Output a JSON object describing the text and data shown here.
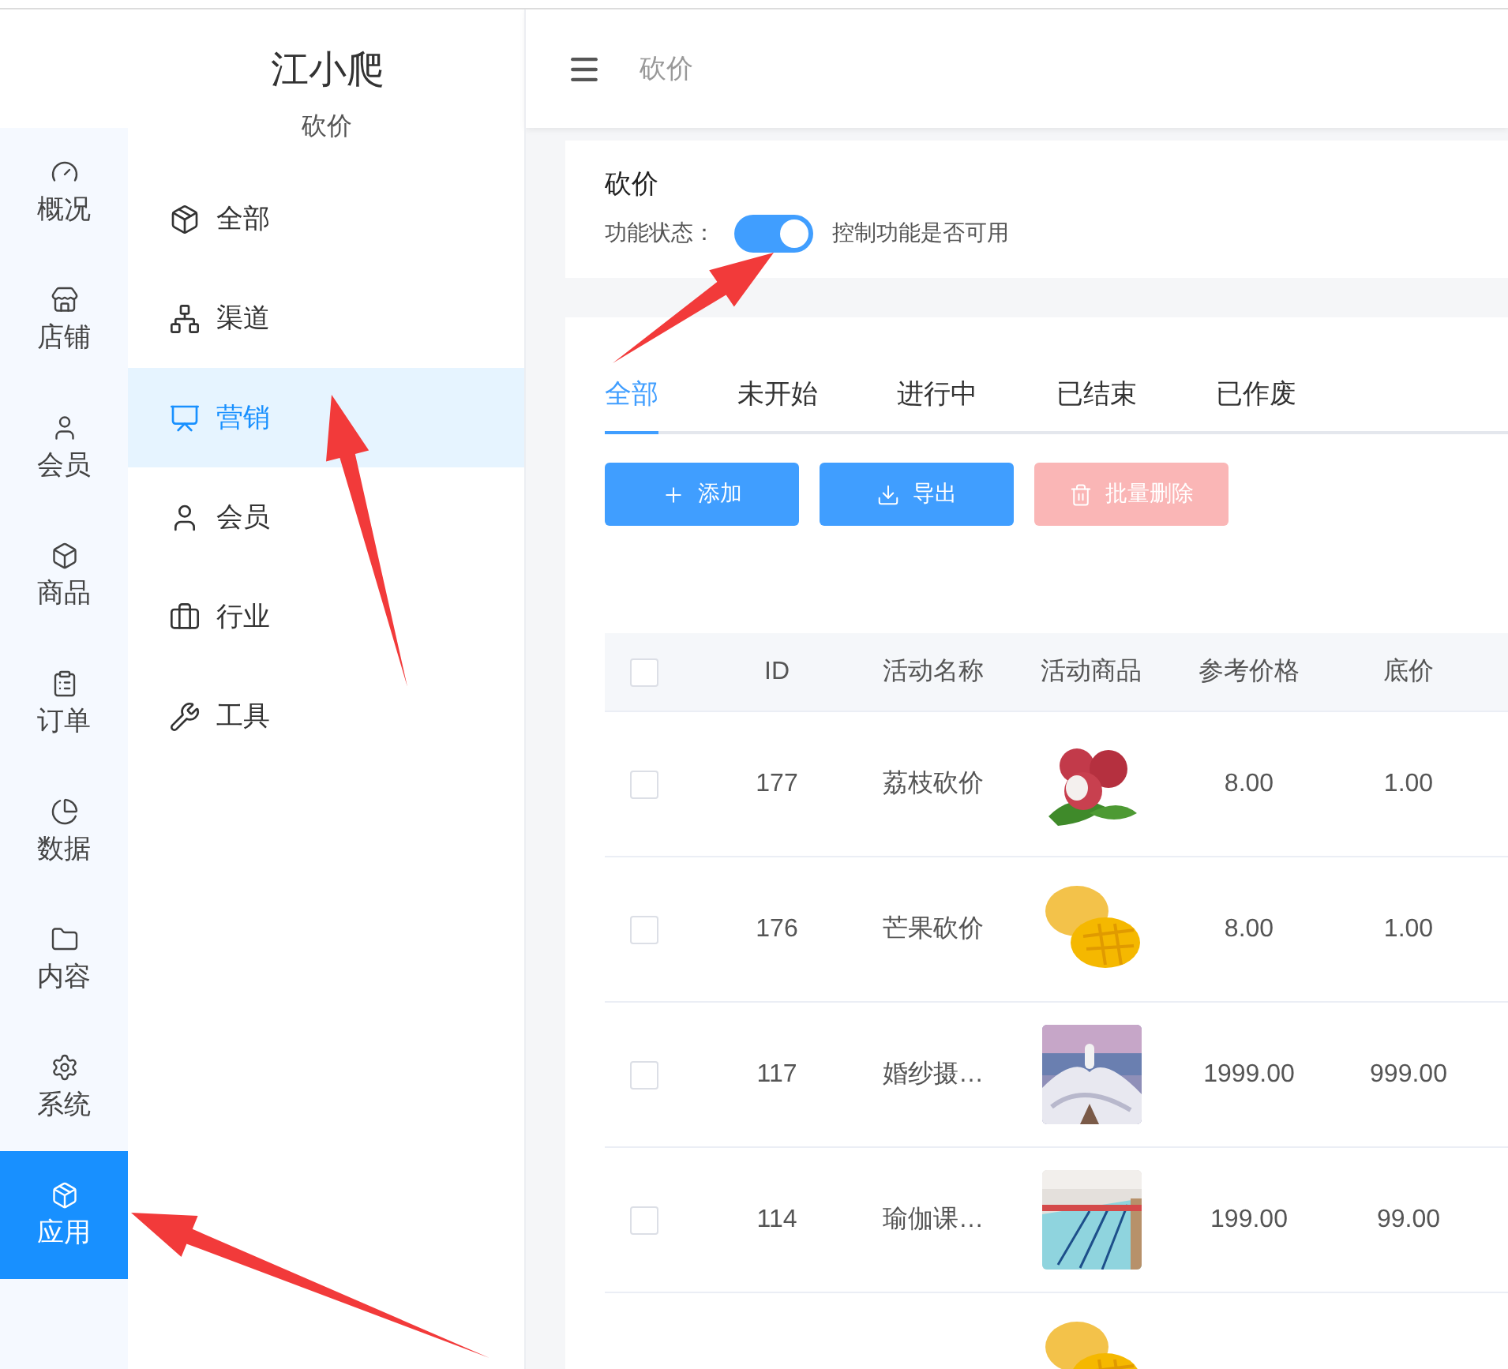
{
  "brand": {
    "title": "江小爬",
    "subtitle": "砍价"
  },
  "rail": [
    {
      "label": "概况",
      "selected": false
    },
    {
      "label": "店铺",
      "selected": false
    },
    {
      "label": "会员",
      "selected": false
    },
    {
      "label": "商品",
      "selected": false
    },
    {
      "label": "订单",
      "selected": false
    },
    {
      "label": "数据",
      "selected": false
    },
    {
      "label": "内容",
      "selected": false
    },
    {
      "label": "系统",
      "selected": false
    },
    {
      "label": "应用",
      "selected": true
    }
  ],
  "submenu": [
    {
      "label": "全部",
      "selected": false
    },
    {
      "label": "渠道",
      "selected": false
    },
    {
      "label": "营销",
      "selected": true
    },
    {
      "label": "会员",
      "selected": false
    },
    {
      "label": "行业",
      "selected": false
    },
    {
      "label": "工具",
      "selected": false
    }
  ],
  "header": {
    "breadcrumb": "砍价"
  },
  "feature": {
    "title": "砍价",
    "label": "功能状态：",
    "on": true,
    "hint": "控制功能是否可用"
  },
  "tabs": [
    {
      "label": "全部",
      "selected": true
    },
    {
      "label": "未开始",
      "selected": false
    },
    {
      "label": "进行中",
      "selected": false
    },
    {
      "label": "已结束",
      "selected": false
    },
    {
      "label": "已作废",
      "selected": false
    }
  ],
  "buttons": [
    {
      "label": "添加",
      "disabled": false
    },
    {
      "label": "导出",
      "disabled": false
    },
    {
      "label": "批量删除",
      "disabled": true
    }
  ],
  "table": {
    "header_checked": false,
    "columns": [
      "ID",
      "活动名称",
      "活动商品",
      "参考价格",
      "底价"
    ],
    "rows": [
      {
        "checked": false,
        "id": "177",
        "name": "荔枝砍价",
        "image": {
          "kind": "picture"
        },
        "price": "8.00",
        "floor": "1.00"
      },
      {
        "checked": false,
        "id": "176",
        "name": "芒果砍价",
        "image": {
          "kind": "picture"
        },
        "price": "8.00",
        "floor": "1.00"
      },
      {
        "checked": false,
        "id": "117",
        "name": "婚纱摄…",
        "image": {
          "kind": "picture"
        },
        "price": "1999.00",
        "floor": "999.00"
      },
      {
        "checked": false,
        "id": "114",
        "name": "瑜伽课…",
        "image": {
          "kind": "picture"
        },
        "price": "199.00",
        "floor": "99.00"
      },
      {
        "image": {
          "kind": "picture"
        }
      }
    ]
  }
}
